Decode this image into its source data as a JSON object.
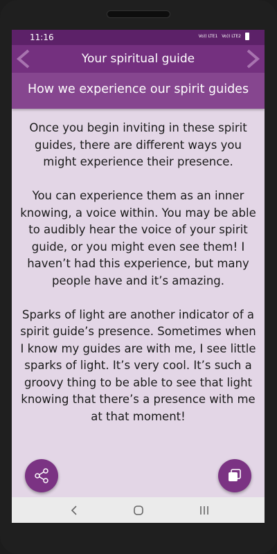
{
  "status_bar": {
    "time": "11:16",
    "sim1": "Vo)) LTE1",
    "sim2": "Vo)) LTE2"
  },
  "app_bar": {
    "title": "Your spiritual guide",
    "prev_icon": "chevron-left-icon",
    "next_icon": "chevron-right-icon"
  },
  "section": {
    "title": "How we experience our spirit guides"
  },
  "content": {
    "paragraphs": [
      "Once you begin inviting in these spirit guides, there are different ways you might experience their presence.",
      "You can experience them as an inner knowing, a voice within. You may be able to audibly hear the voice of your spirit guide, or you might even see them! I haven’t had this experience, but many people have and it’s amazing.",
      "Sparks of light are another indicator of a spirit guide’s presence. Sometimes when I know my guides are with me, I see little sparks of light. It’s very cool. It’s such a groovy thing to be able to see that light knowing that there’s a presence with me at that moment!"
    ]
  },
  "fabs": {
    "share_icon": "share-icon",
    "copy_icon": "copy-icon"
  },
  "colors": {
    "status_bar": "#5c2168",
    "app_bar": "#74307f",
    "section_header": "#86468f",
    "background": "#e3d6e6",
    "fab": "#7b3383"
  }
}
